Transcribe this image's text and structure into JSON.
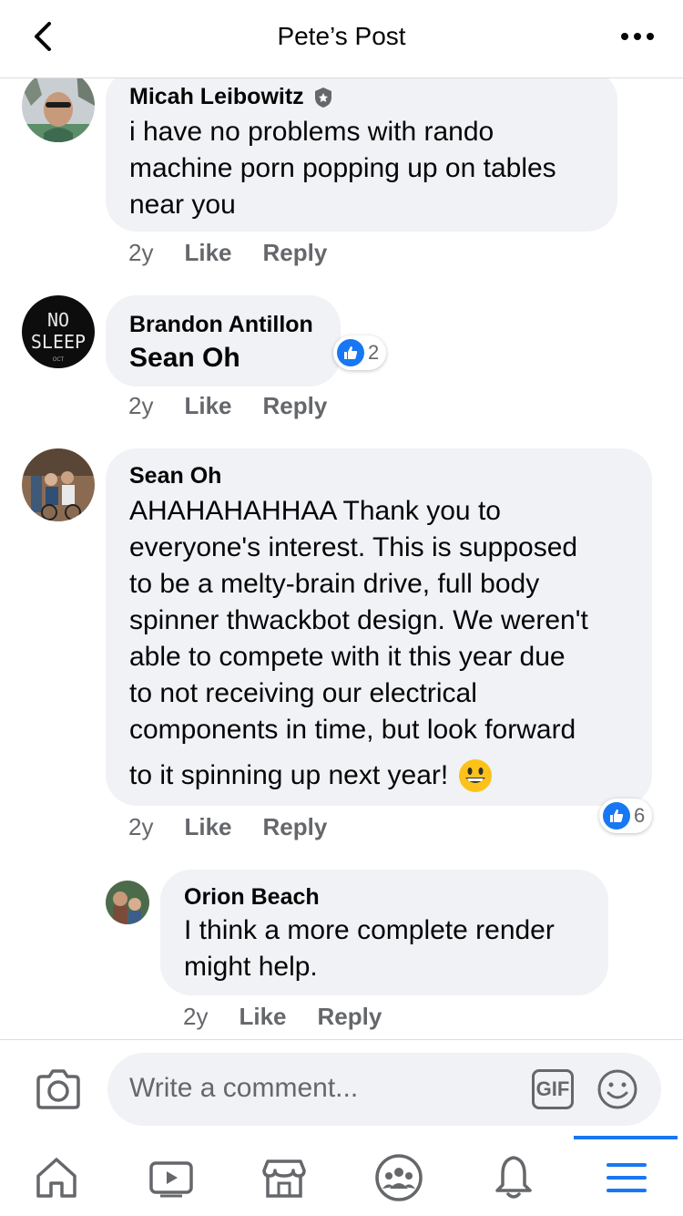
{
  "header": {
    "title": "Pete’s Post"
  },
  "comments": [
    {
      "author": "Micah Leibowitz",
      "text_lines": [
        "i have no problems with rando",
        "machine porn popping up on tables",
        "near you"
      ],
      "time": "2y",
      "like": "Like",
      "reply": "Reply"
    },
    {
      "author": "Brandon Antillon",
      "text_lines": [
        "Sean Oh"
      ],
      "time": "2y",
      "like": "Like",
      "reply": "Reply",
      "reactions": "2"
    },
    {
      "author": "Sean Oh",
      "text_lines": [
        "AHAHAHAHHAA Thank you to",
        "everyone's interest. This is supposed",
        "to be a melty-brain drive, full body",
        "spinner thwackbot design. We weren't",
        "able to compete with it this year due",
        "to not receiving our electrical",
        "components in time, but look forward",
        "to it spinning up next year!"
      ],
      "time": "2y",
      "like": "Like",
      "reply": "Reply",
      "reactions": "6"
    },
    {
      "author": "Orion Beach",
      "text_lines": [
        "I think a more complete render",
        "might help."
      ],
      "time": "2y",
      "like": "Like",
      "reply": "Reply"
    }
  ],
  "avatar_text": {
    "line1": "NO",
    "line2": "SLEEP",
    "line3": "OCT"
  },
  "composer": {
    "placeholder": "Write a comment...",
    "gif_label": "GIF"
  },
  "colors": {
    "accent": "#1877f2",
    "bubble": "#f0f2f5",
    "muted": "#65676b"
  },
  "nav": {
    "icons": [
      "home-icon",
      "watch-icon",
      "marketplace-icon",
      "groups-icon",
      "notifications-icon",
      "menu-icon"
    ],
    "active": "menu-icon"
  }
}
